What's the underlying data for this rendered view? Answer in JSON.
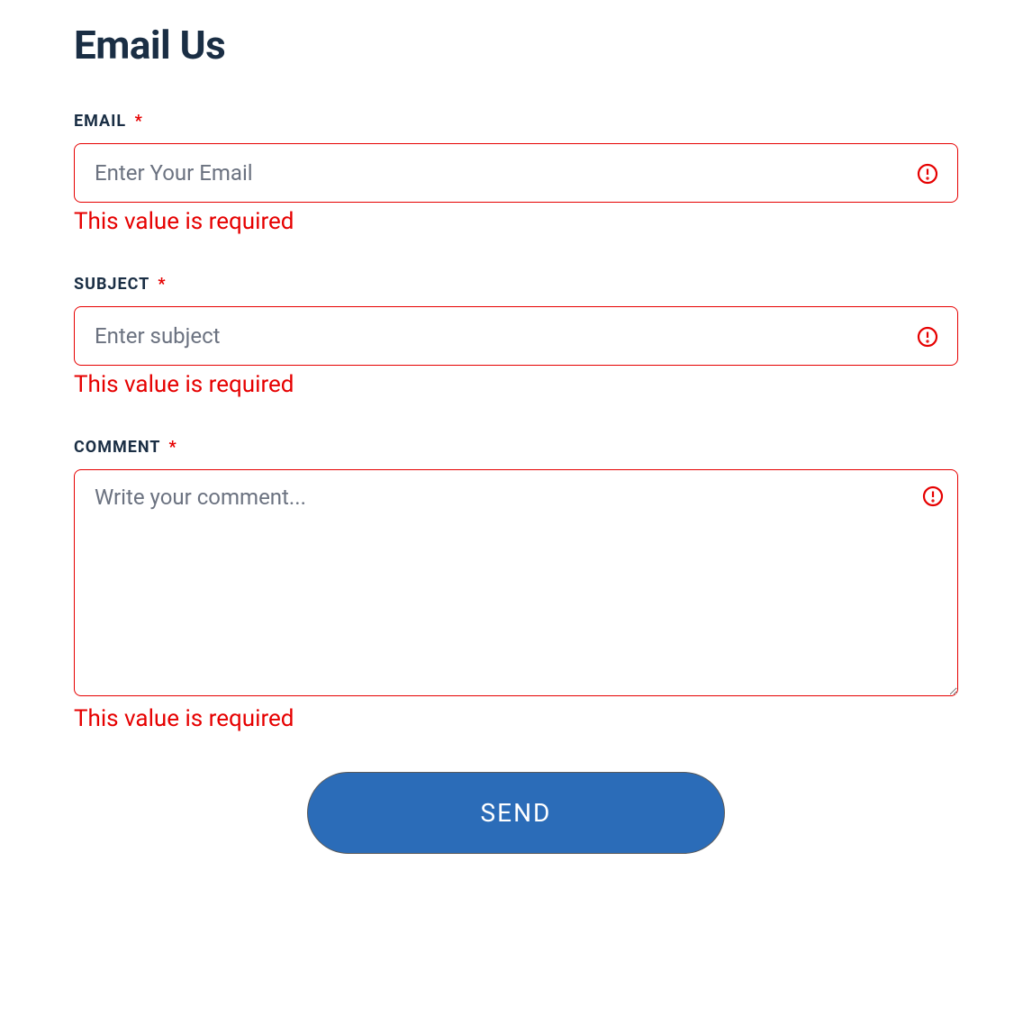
{
  "page": {
    "title": "Email Us"
  },
  "form": {
    "email": {
      "label": "EMAIL",
      "required_mark": "*",
      "placeholder": "Enter Your Email",
      "value": "",
      "error": "This value is required"
    },
    "subject": {
      "label": "SUBJECT",
      "required_mark": "*",
      "placeholder": "Enter subject",
      "value": "",
      "error": "This value is required"
    },
    "comment": {
      "label": "COMMENT",
      "required_mark": "*",
      "placeholder": "Write your comment...",
      "value": "",
      "error": "This value is required"
    },
    "submit_label": "SEND"
  },
  "colors": {
    "error": "#e60000",
    "primary": "#2b6cb8",
    "heading": "#1a2e44"
  }
}
